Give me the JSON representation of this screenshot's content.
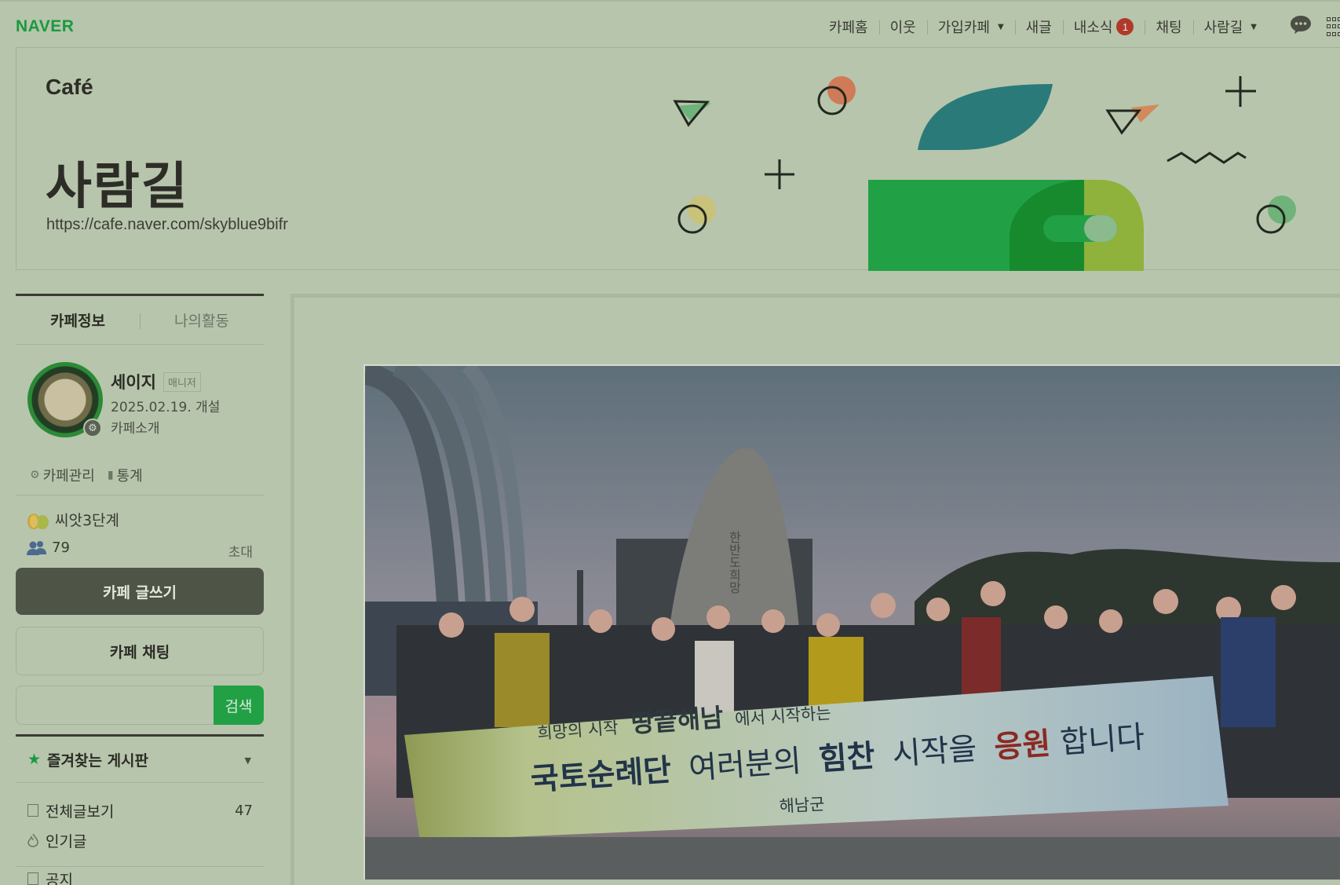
{
  "gnb": {
    "brand": "NAVER",
    "menu": [
      {
        "label": "카페홈"
      },
      {
        "label": "이웃"
      },
      {
        "label": "가입카페",
        "has_caret": true
      },
      {
        "label": "새글"
      },
      {
        "label": "내소식",
        "badge": "1"
      },
      {
        "label": "채팅"
      },
      {
        "label": "사람길",
        "has_caret": true
      }
    ],
    "chat_icon": "speech-bubble-icon",
    "apps_icon": "grid-apps-icon"
  },
  "header": {
    "logo": "Café",
    "cafe_name": "사람길",
    "cafe_url": "https://cafe.naver.com/skyblue9bifr"
  },
  "sidebar": {
    "tabs": [
      {
        "label": "카페정보",
        "active": true
      },
      {
        "label": "나의활동",
        "active": false
      }
    ],
    "profile": {
      "manager_name": "세이지",
      "manager_tag": "매니저",
      "open_date": "2025.02.19. 개설",
      "intro_link": "카페소개"
    },
    "admin": {
      "manage_label": "카페관리",
      "stats_label": "통계"
    },
    "level": "씨앗3단계",
    "member_count": "79",
    "invite_label": "초대",
    "write_button": "카페 글쓰기",
    "chat_button": "카페 채팅",
    "search": {
      "value": "",
      "button": "검색"
    },
    "favorites_label": "즐겨찾는 게시판",
    "boards": [
      {
        "label": "전체글보기",
        "count": "47",
        "icon": "list-icon"
      },
      {
        "label": "인기글",
        "count": "",
        "icon": "flame-icon"
      }
    ],
    "next_board_partial": "공지"
  },
  "main": {
    "photo": {
      "banner_line1_left": "희망의 시작",
      "banner_line1_brand": "땅끝해남",
      "banner_line1_right": "에서 시작하는",
      "banner_line2_a": "국토순례단",
      "banner_line2_b": "여러분의",
      "banner_line2_c": "힘찬",
      "banner_line2_d": "시작을",
      "banner_line2_e": "응원",
      "banner_line2_f": "합니다",
      "banner_sponsor": "해남군",
      "monument_text": "한반도희망"
    }
  },
  "colors": {
    "brand_green": "#1a9a3f",
    "write_button_bg": "#4e5547",
    "search_button_bg": "#22a046",
    "badge_red": "#b0392b"
  }
}
